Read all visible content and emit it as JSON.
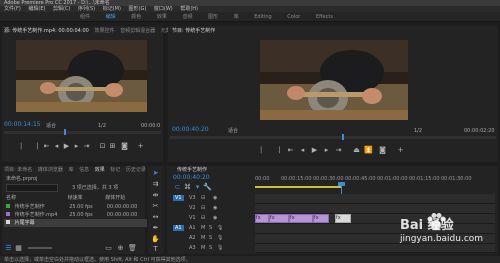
{
  "menubar": {
    "app_title": "Adobe Premiere Pro CC 2017 - D:\\...\\未命名",
    "items": [
      "文件(F)",
      "编辑(E)",
      "剪辑(C)",
      "序列(S)",
      "标记(M)",
      "图形(G)",
      "窗口(W)",
      "帮助(H)"
    ]
  },
  "workspace_tabs": [
    "组件",
    "编辑",
    "颜色",
    "效果",
    "音频",
    "图形",
    "库",
    "Editing",
    "Color",
    "Effects"
  ],
  "source_panel": {
    "header_tabs": [
      "源: 传统手艺制作.mp4: 00:00:04:00",
      "效果控件",
      "音频剪辑混合器",
      "元数据"
    ],
    "timecode_left": "00:00:14:15",
    "fit": "适合",
    "fraction": "1/2",
    "timecode_right": "00:00:0"
  },
  "program_panel": {
    "header_tab": "节目: 传统手艺制作",
    "timecode_left": "00:00:40:20",
    "fit": "适合",
    "fraction": "1/2",
    "timecode_right": "00:00:02:20"
  },
  "project_panel": {
    "tabs": [
      "项目: 未命名",
      "媒体浏览器",
      "库",
      "信息",
      "效果",
      "标记",
      "历史记录"
    ],
    "project_name": "未命名.prproj",
    "search_placeholder": "",
    "item_count": "3 项已选择，共 3 项",
    "columns": [
      "名称",
      "帧速率",
      "媒体开始"
    ],
    "rows": [
      {
        "name": "传统手艺制作",
        "fps": "25.00 fps",
        "start": "00:00:00:00"
      },
      {
        "name": "传统手艺制作.mp4",
        "fps": "25.00 fps",
        "start": "00:00:00:00"
      },
      {
        "name": "片尾字幕",
        "fps": "",
        "start": ""
      }
    ]
  },
  "timeline_panel": {
    "tab": "传统手艺制作",
    "timecode": "00:00:40:20",
    "ruler": [
      "00:00",
      "00:00:15:00",
      "00:00:30:00",
      "00:00:45:00",
      "00:01:00:00",
      "00:01:15:00",
      "00:01:30:00",
      "00:01:45:00"
    ],
    "tracks_v": [
      "V3",
      "V2",
      "V1"
    ],
    "tracks_a": [
      "A1",
      "A2",
      "A3"
    ],
    "clip_labels": [
      "fx",
      "fx",
      "fx",
      "fx",
      "fx"
    ]
  },
  "statusbar": {
    "text": "单击以选择，或单击空白处并拖动以框选。使用 Shift, Alt 和 Ctrl 可获得其他选项。"
  },
  "watermark": {
    "line1": "Bai 经验",
    "line2": "jingyan.baidu.com"
  }
}
